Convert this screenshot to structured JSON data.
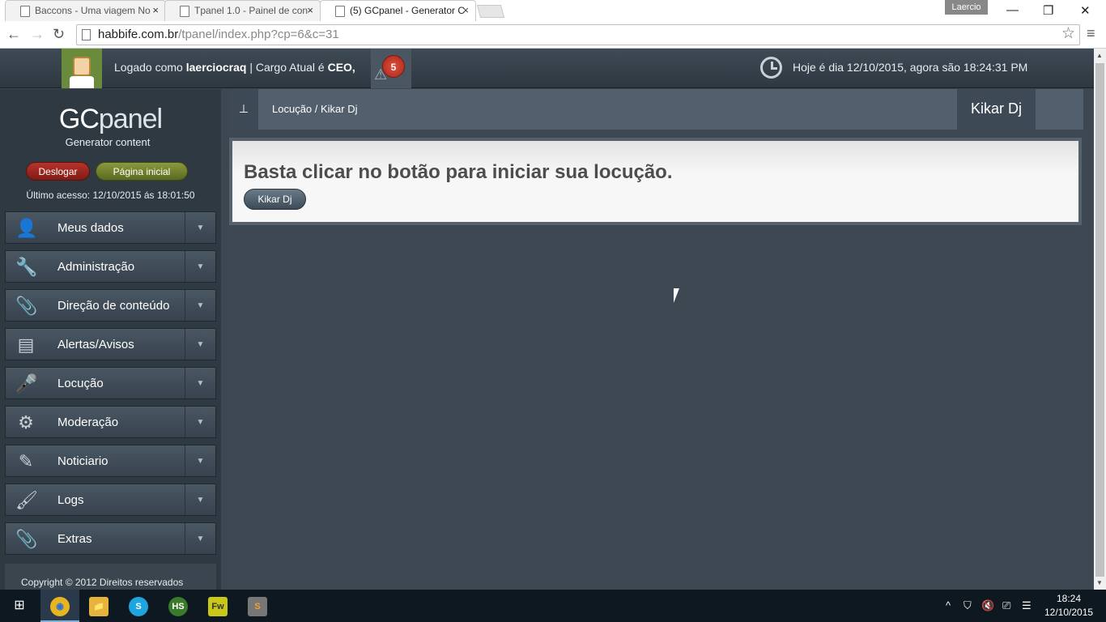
{
  "browser": {
    "tabs": [
      {
        "title": "Baccons - Uma viagem No",
        "close": "×"
      },
      {
        "title": "Tpanel 1.0 - Painel de con",
        "close": "×"
      },
      {
        "title": "(5) GCpanel - Generator C",
        "close": "×"
      }
    ],
    "user_label": "Laercio",
    "controls": {
      "minimize": "—",
      "restore": "❐",
      "close": "✕"
    },
    "url_domain": "habbife.com.br",
    "url_path": "/tpanel/index.php?cp=6&c=31",
    "back": "←",
    "forward": "→",
    "reload": "↻",
    "star": "☆",
    "menu": "≡"
  },
  "topbar": {
    "logged_prefix": "Logado como ",
    "username": "laerciocraq",
    "role_prefix": " | Cargo Atual é ",
    "role": "CEO,",
    "notifications": "5",
    "warning_icon": "⚠",
    "datetime": "Hoje é dia 12/10/2015, agora são 18:24:31 PM"
  },
  "sidebar": {
    "logo_gc": "GC",
    "logo_panel": "panel",
    "subtitle": "Generator content",
    "logout_label": "Deslogar",
    "home_label": "Página inicial",
    "last_access": "Último acesso: 12/10/2015 ás 18:01:50",
    "items": [
      {
        "label": "Meus dados",
        "icon": "👤"
      },
      {
        "label": "Administração",
        "icon": "🔧"
      },
      {
        "label": "Direção de conteúdo",
        "icon": "📎"
      },
      {
        "label": "Alertas/Avisos",
        "icon": "▤"
      },
      {
        "label": "Locução",
        "icon": "🎤"
      },
      {
        "label": "Moderação",
        "icon": "⚙"
      },
      {
        "label": "Noticiario",
        "icon": "✎"
      },
      {
        "label": "Logs",
        "icon": "🖌"
      },
      {
        "label": "Extras",
        "icon": "📎"
      }
    ],
    "dropdown_glyph": "▼",
    "copyright": "Copyright © 2012 Direitos reservados"
  },
  "main": {
    "breadcrumb_icon": "⊥",
    "breadcrumb": "Locução / Kikar Dj",
    "page_title": "Kikar Dj",
    "headline": "Basta clicar no botão para iniciar sua locução.",
    "button_label": "Kikar Dj"
  },
  "taskbar": {
    "start": "⊞",
    "apps": [
      {
        "name": "chrome",
        "label": "◉"
      },
      {
        "name": "explorer",
        "label": "📁"
      },
      {
        "name": "skype",
        "label": "S"
      },
      {
        "name": "hs",
        "label": "HS"
      },
      {
        "name": "fireworks",
        "label": "Fw"
      },
      {
        "name": "sublime",
        "label": "S"
      }
    ],
    "tray_icons": [
      "^",
      "⛉",
      "🔇",
      "⎚",
      "☰"
    ],
    "time": "18:24",
    "date": "12/10/2015"
  }
}
